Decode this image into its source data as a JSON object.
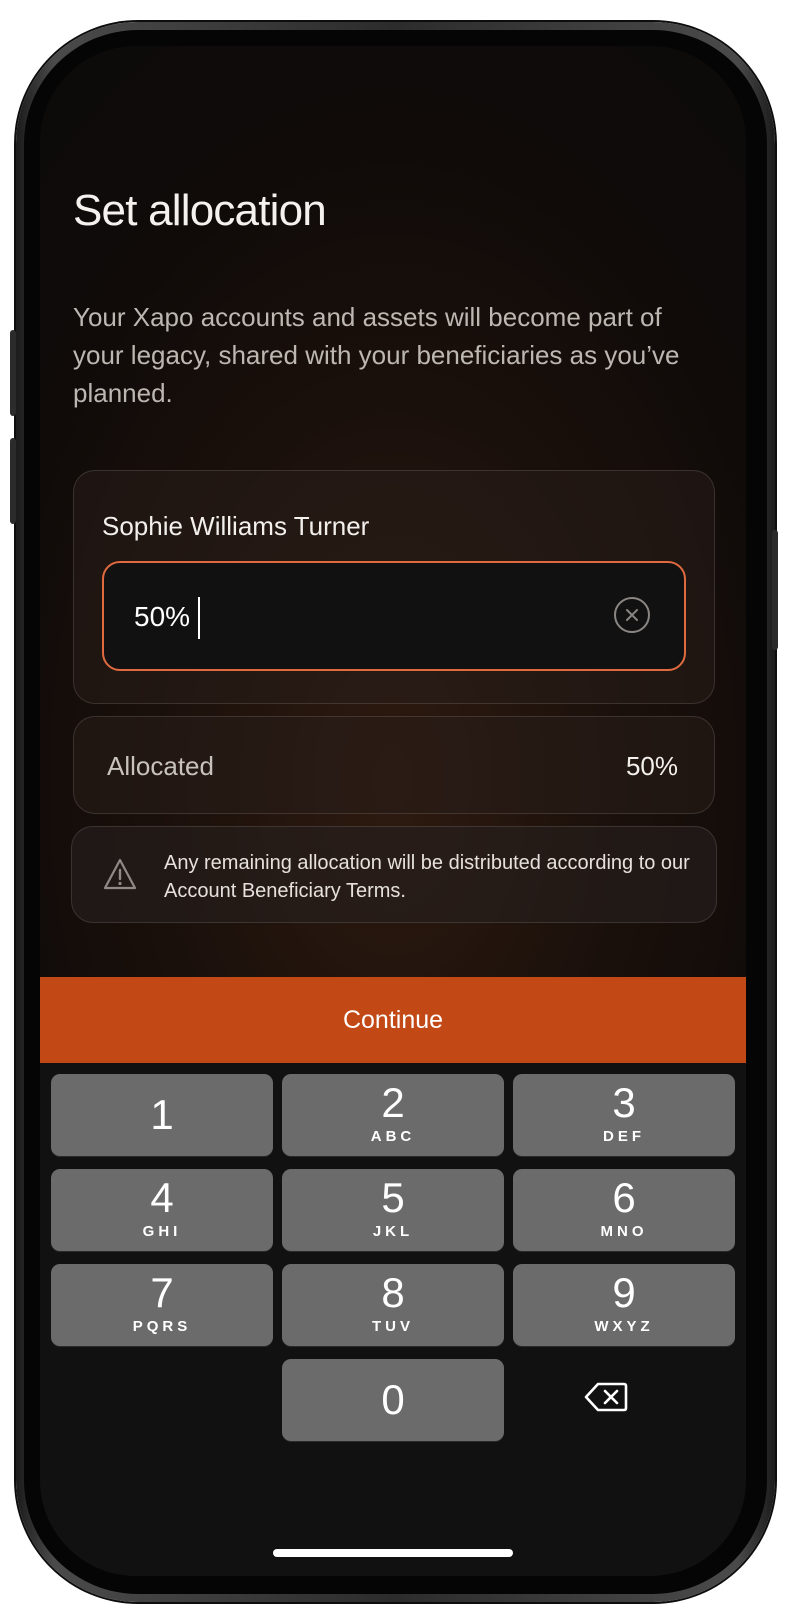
{
  "header": {
    "title": "Set allocation"
  },
  "intro": {
    "text": "Your Xapo accounts and assets will become part of your legacy, shared with your beneficiaries as you’ve planned."
  },
  "beneficiary": {
    "name": "Sophie Williams Turner",
    "percent_input": "50%"
  },
  "allocated": {
    "label": "Allocated",
    "value": "50%"
  },
  "notice": {
    "text": "Any remaining allocation will be distributed according to our Account Beneficiary Terms."
  },
  "continue_label": "Continue",
  "keypad": {
    "keys": [
      {
        "digit": "1",
        "letters": ""
      },
      {
        "digit": "2",
        "letters": "ABC"
      },
      {
        "digit": "3",
        "letters": "DEF"
      },
      {
        "digit": "4",
        "letters": "GHI"
      },
      {
        "digit": "5",
        "letters": "JKL"
      },
      {
        "digit": "6",
        "letters": "MNO"
      },
      {
        "digit": "7",
        "letters": "PQRS"
      },
      {
        "digit": "8",
        "letters": "TUV"
      },
      {
        "digit": "9",
        "letters": "WXYZ"
      },
      {
        "digit": "0",
        "letters": ""
      }
    ]
  },
  "colors": {
    "accent": "#c24815",
    "input_border": "#e06a3f",
    "key_background": "#6b6b6b",
    "keypad_background": "#111111"
  }
}
